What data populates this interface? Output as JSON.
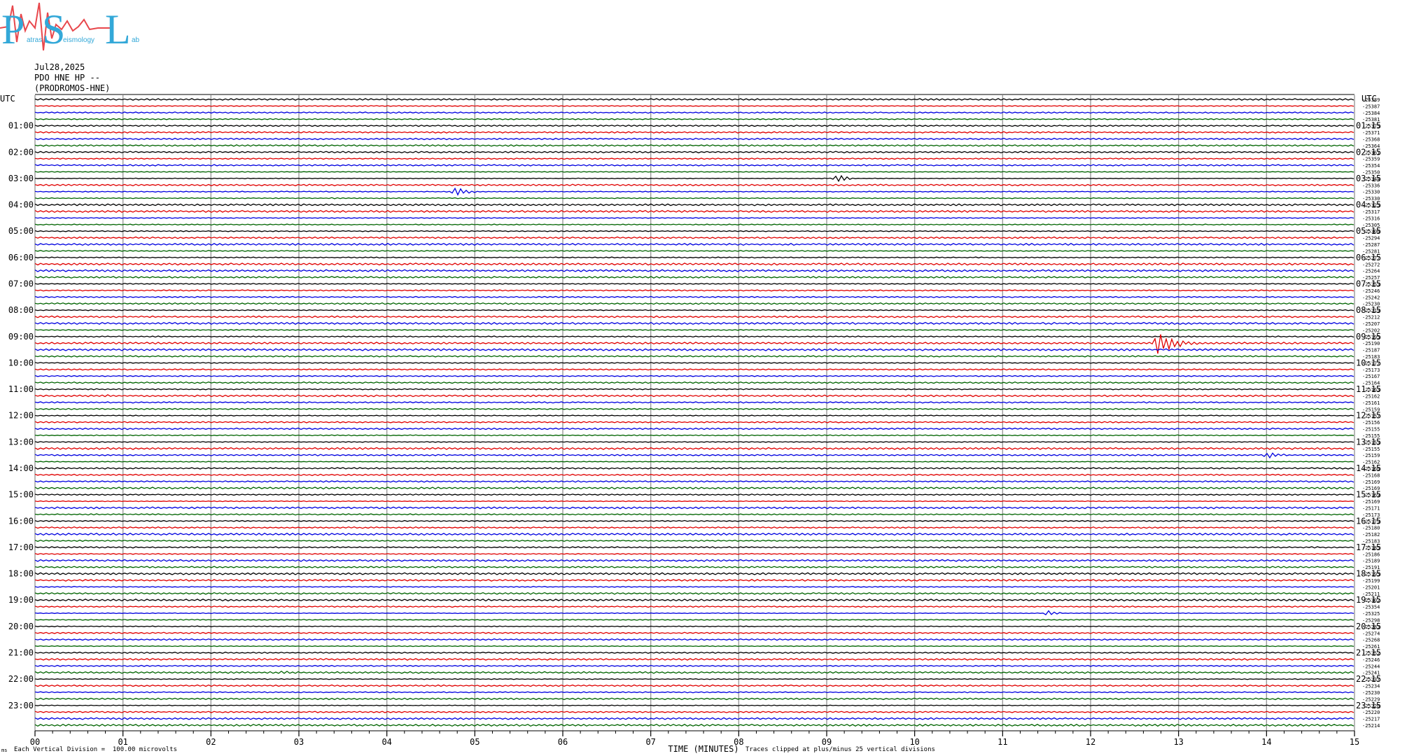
{
  "header": {
    "date": "Jul28,2025",
    "station": "PDO HNE HP --",
    "site": "(PRODROMOS-HNE)"
  },
  "logo": {
    "letters": [
      "P",
      "S",
      "L"
    ],
    "small_text": [
      "atras",
      "eismology",
      "ab"
    ],
    "colors": {
      "letters": "#33a8d8",
      "trace": "#e8474c"
    }
  },
  "footer": {
    "left_mark": "ms",
    "scale_note": "Each Vertical Division =  100.00 microvolts",
    "xlabel": "TIME (MINUTES)",
    "clip_note": "Traces clipped at plus/minus 25 vertical divisions"
  },
  "chart_data": {
    "type": "line",
    "title": "",
    "left_axis_label": "UTC",
    "right_axis_label": "UTC",
    "xlabel": "TIME (MINUTES)",
    "xlim": [
      0,
      15
    ],
    "x_ticks": [
      "00",
      "01",
      "02",
      "03",
      "04",
      "05",
      "06",
      "07",
      "08",
      "09",
      "10",
      "11",
      "12",
      "13",
      "14",
      "15"
    ],
    "left_hour_labels": [
      "01:00",
      "02:00",
      "03:00",
      "04:00",
      "05:00",
      "06:00",
      "07:00",
      "08:00",
      "09:00",
      "10:00",
      "11:00",
      "12:00",
      "13:00",
      "14:00",
      "15:00",
      "16:00",
      "17:00",
      "18:00",
      "19:00",
      "20:00",
      "21:00",
      "22:00",
      "23:00"
    ],
    "right_hour_labels": [
      "01:15",
      "02:15",
      "03:15",
      "04:15",
      "05:15",
      "06:15",
      "07:15",
      "08:15",
      "09:15",
      "10:15",
      "11:15",
      "12:15",
      "13:15",
      "14:15",
      "15:15",
      "16:15",
      "17:15",
      "18:15",
      "19:15",
      "20:15",
      "21:15",
      "22:15",
      "23:15"
    ],
    "trace_colors": [
      "#000000",
      "#e00000",
      "#0000e0",
      "#006400"
    ],
    "trace_count": 96,
    "trace_minutes": 15,
    "trace_offsets": [
      "-25389",
      "-25387",
      "-25384",
      "-25381",
      "-25375",
      "-25371",
      "-25368",
      "-25364",
      "-25361",
      "-25359",
      "-25354",
      "-25350",
      "-25344",
      "-25336",
      "-25330",
      "-25330",
      "-25325",
      "-25317",
      "-25316",
      "-25305",
      "-25306",
      "-25294",
      "-25287",
      "-25281",
      "-25277",
      "-25272",
      "-25264",
      "-25257",
      "-25253",
      "-25246",
      "-25242",
      "-25230",
      "-25219",
      "-25212",
      "-25207",
      "-25202",
      "-25195",
      "-25190",
      "-25187",
      "-25183",
      "-25177",
      "-25173",
      "-25167",
      "-25164",
      "-25163",
      "-25162",
      "-25161",
      "-25159",
      "-25157",
      "-25156",
      "-25155",
      "-25155",
      "-25153",
      "-25155",
      "-25159",
      "-25162",
      "-25166",
      "-25168",
      "-25169",
      "-25169",
      "-25169",
      "-25169",
      "-25171",
      "-25173",
      "-25179",
      "-25180",
      "-25182",
      "-25183",
      "-25185",
      "-25186",
      "-25189",
      "-25191",
      "-25195",
      "-25199",
      "-25201",
      "-25211",
      "-25302",
      "-25354",
      "-25325",
      "-25298",
      "-25283",
      "-25274",
      "-25268",
      "-25261",
      "-25252",
      "-25246",
      "-25244",
      "-25241",
      "-25237",
      "-25234",
      "-25230",
      "-25229",
      "-25226",
      "-25220",
      "-25217",
      "-25214"
    ],
    "events": [
      {
        "trace": 12,
        "minute": 9.1,
        "duration": 0.25,
        "amplitude": 7
      },
      {
        "trace": 14,
        "minute": 4.75,
        "duration": 0.3,
        "amplitude": 8
      },
      {
        "trace": 15,
        "minute": 3.35,
        "duration": 0.15,
        "amplitude": 3
      },
      {
        "trace": 37,
        "minute": 12.75,
        "duration": 0.5,
        "amplitude": 16
      },
      {
        "trace": 37,
        "minute": 14.2,
        "duration": 0.3,
        "amplitude": 2
      },
      {
        "trace": 45,
        "minute": 0.8,
        "duration": 0.3,
        "amplitude": 2
      },
      {
        "trace": 54,
        "minute": 14.0,
        "duration": 0.4,
        "amplitude": 5
      },
      {
        "trace": 78,
        "minute": 11.5,
        "duration": 0.2,
        "amplitude": 6
      },
      {
        "trace": 85,
        "minute": 7.2,
        "duration": 0.15,
        "amplitude": 3
      },
      {
        "trace": 87,
        "minute": 2.8,
        "duration": 0.3,
        "amplitude": 3
      }
    ]
  }
}
